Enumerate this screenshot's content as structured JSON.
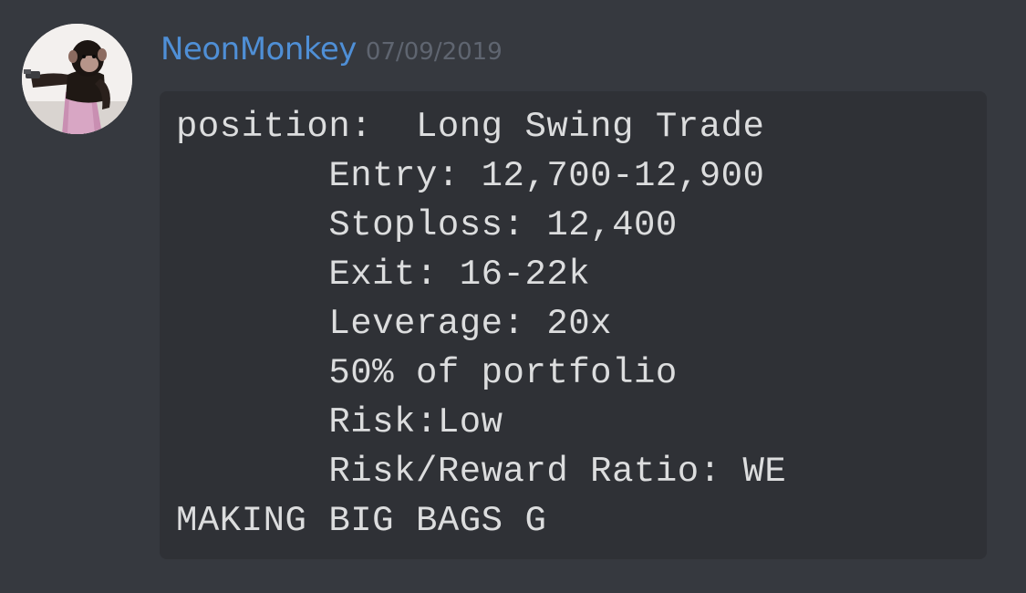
{
  "message": {
    "author": "NeonMonkey",
    "timestamp": "07/09/2019",
    "avatar_icon": "chimpanzee-with-gun-avatar",
    "code_lines": [
      "position:  Long Swing Trade",
      "       Entry: 12,700-12,900",
      "       Stoploss: 12,400",
      "       Exit: 16-22k",
      "       Leverage: 20x",
      "       50% of portfolio",
      "       Risk:Low",
      "       Risk/Reward Ratio: WE",
      "MAKING BIG BAGS G"
    ]
  },
  "colors": {
    "background": "#36393f",
    "codeblock_background": "#2f3136",
    "username": "#4f8fd6",
    "timestamp": "#5f6570",
    "code_text": "#dcddde"
  }
}
